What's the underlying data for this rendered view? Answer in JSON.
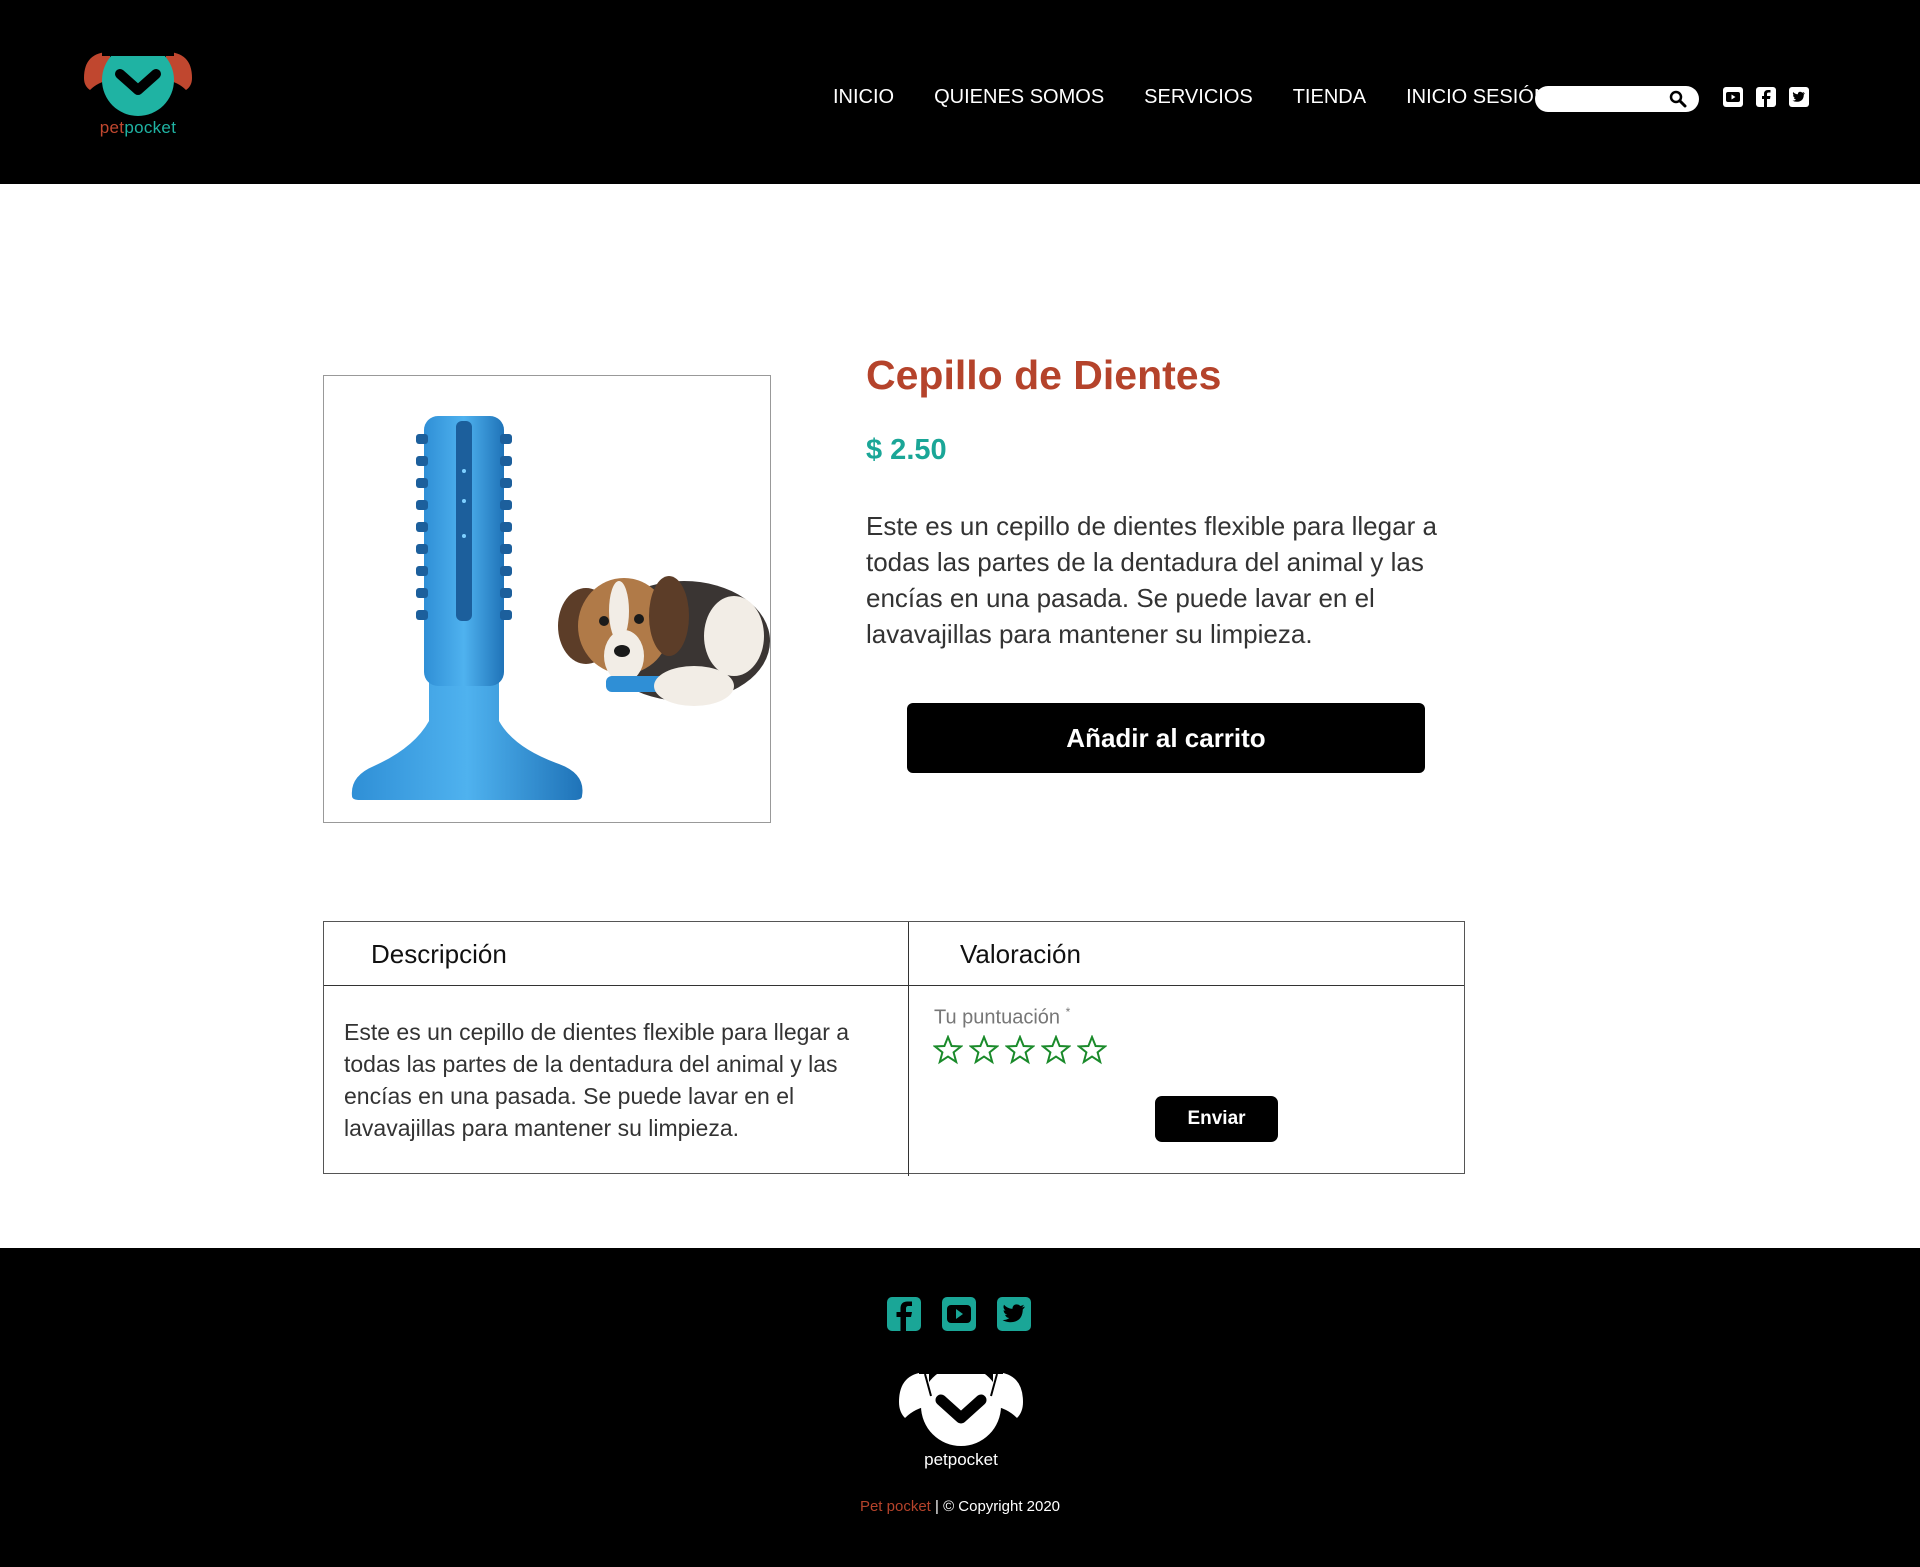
{
  "brand": {
    "pet": "pet",
    "pocket": "pocket",
    "name": "petpocket"
  },
  "nav": {
    "items": [
      "INICIO",
      "QUIENES SOMOS",
      "SERVICIOS",
      "TIENDA",
      "INICIO SESIÓN"
    ]
  },
  "search": {
    "placeholder": ""
  },
  "product": {
    "title": "Cepillo de Dientes",
    "price": "$ 2.50",
    "description": "Este es un cepillo de dientes flexible para llegar a todas las partes de la dentadura del animal y las encías en una pasada. Se puede lavar en el lavavajillas para mantener su limpieza.",
    "cart_label": "Añadir al carrito"
  },
  "tabs": {
    "description_heading": "Descripción",
    "rating_heading": "Valoración",
    "description_text": "Este es un cepillo de dientes flexible para llegar a todas las partes de la dentadura del animal y las encías en una pasada. Se puede lavar en el lavavajillas para mantener su limpieza.",
    "score_label": "Tu puntuación",
    "score_required": "*",
    "star_count": 5,
    "send_label": "Enviar"
  },
  "footer": {
    "brand_name": "Pet pocket",
    "copyright": " | © Copyright 2020",
    "logo_text": "petpocket"
  },
  "colors": {
    "brand_red": "#b5432b",
    "brand_teal": "#1aa697",
    "star_green": "#1a8a2a"
  },
  "icons": {
    "header_social": [
      "youtube-icon",
      "facebook-icon",
      "twitter-icon"
    ],
    "footer_social": [
      "facebook-icon",
      "youtube-icon",
      "twitter-icon"
    ]
  }
}
